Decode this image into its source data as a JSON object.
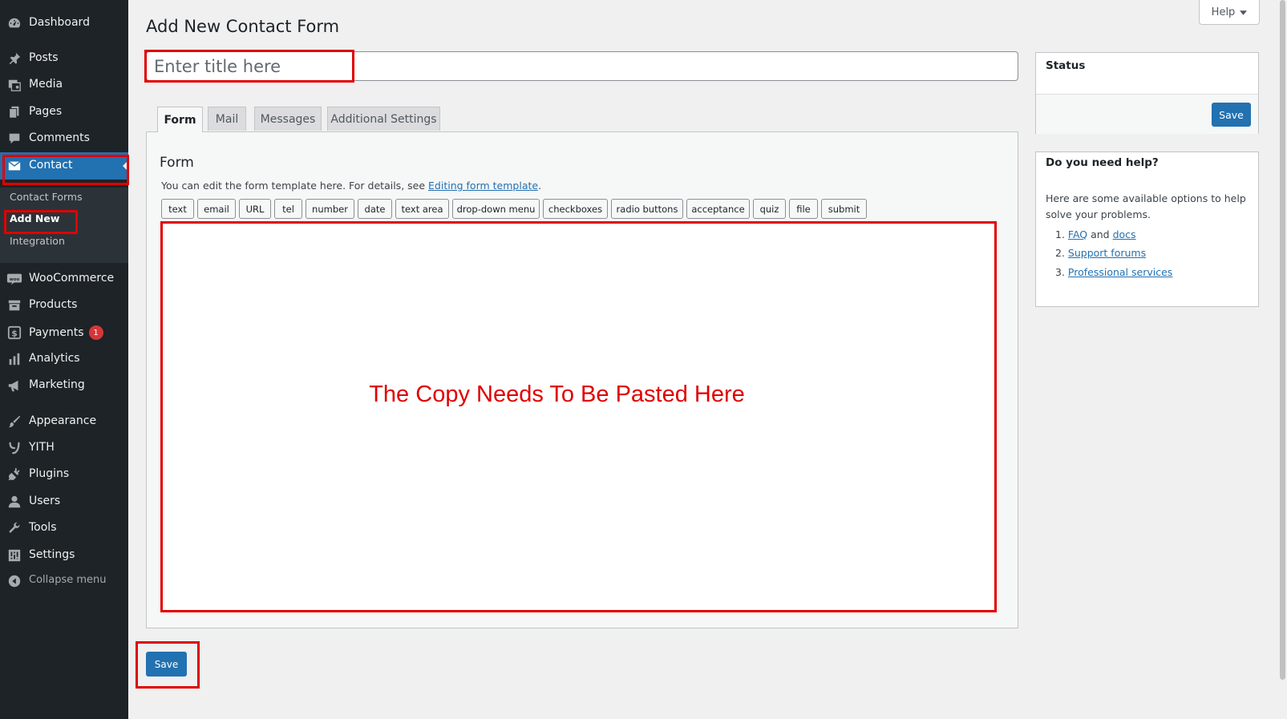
{
  "sidebar": {
    "items": [
      {
        "label": "Dashboard",
        "icon": "dashboard-icon"
      },
      {
        "label": "Posts",
        "icon": "pin-icon"
      },
      {
        "label": "Media",
        "icon": "media-icon"
      },
      {
        "label": "Pages",
        "icon": "pages-icon"
      },
      {
        "label": "Comments",
        "icon": "comment-icon"
      },
      {
        "label": "Contact",
        "icon": "mail-icon"
      },
      {
        "label": "WooCommerce",
        "icon": "woo-icon"
      },
      {
        "label": "Products",
        "icon": "archive-icon"
      },
      {
        "label": "Payments",
        "icon": "dollar-icon"
      },
      {
        "label": "Analytics",
        "icon": "chart-bar-icon"
      },
      {
        "label": "Marketing",
        "icon": "megaphone-icon"
      },
      {
        "label": "Appearance",
        "icon": "brush-icon"
      },
      {
        "label": "YITH",
        "icon": "yith-icon"
      },
      {
        "label": "Plugins",
        "icon": "plugin-icon"
      },
      {
        "label": "Users",
        "icon": "user-icon"
      },
      {
        "label": "Tools",
        "icon": "wrench-icon"
      },
      {
        "label": "Settings",
        "icon": "settings-icon"
      }
    ],
    "payments_badge": "1",
    "submenu": [
      "Contact Forms",
      "Add New",
      "Integration"
    ],
    "collapse_label": "Collapse menu"
  },
  "header": {
    "title": "Add New Contact Form",
    "help_label": "Help"
  },
  "title_field": {
    "placeholder": "Enter title here",
    "value": ""
  },
  "tabs": [
    "Form",
    "Mail",
    "Messages",
    "Additional Settings"
  ],
  "form_panel": {
    "title": "Form",
    "desc_prefix": "You can edit the form template here. For details, see ",
    "desc_link": "Editing form template",
    "desc_suffix": ".",
    "tag_buttons": [
      "text",
      "email",
      "URL",
      "tel",
      "number",
      "date",
      "text area",
      "drop-down menu",
      "checkboxes",
      "radio buttons",
      "acceptance",
      "quiz",
      "file",
      "submit"
    ],
    "editor_note": "The Copy Needs To Be Pasted Here"
  },
  "save_label": "Save",
  "status_box": {
    "title": "Status",
    "save_label": "Save"
  },
  "help_box": {
    "title": "Do you need help?",
    "text": "Here are some available options to help solve your problems.",
    "li1_link_a": "FAQ",
    "li1_mid": " and ",
    "li1_link_b": "docs",
    "li2_link": "Support forums",
    "li3_link": "Professional services"
  },
  "colors": {
    "sidebar_bg": "#1d2327",
    "accent": "#2271b1",
    "highlight": "#e00000",
    "badge": "#d63638"
  }
}
